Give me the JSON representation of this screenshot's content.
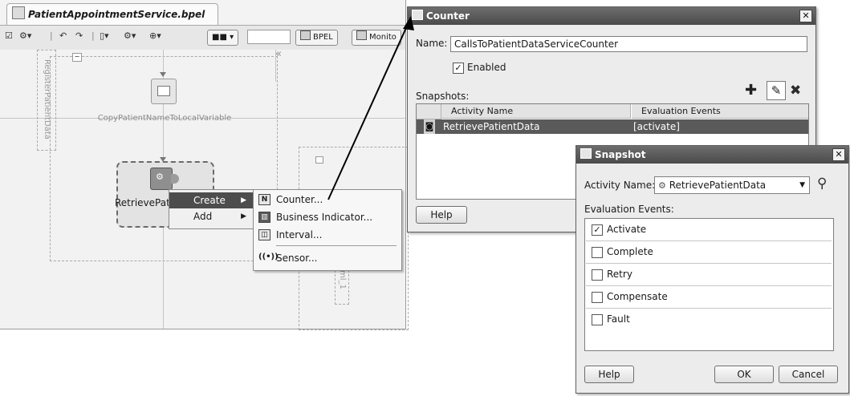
{
  "editor": {
    "tab_title": "PatientAppointmentService.bpel",
    "toolbar": {
      "bpel_button": "BPEL",
      "monitor_button": "Monito"
    },
    "canvas": {
      "swimlane_label": "RegisterPatientData",
      "activity1_label": "CopyPatientNameToLocalVariable",
      "activity2_label": "RetrievePat",
      "side_label": "ml_1"
    }
  },
  "context_menu": {
    "items": [
      {
        "label": "Create"
      },
      {
        "label": "Add"
      }
    ],
    "submenu": [
      {
        "icon": "N",
        "label": "Counter..."
      },
      {
        "icon": "BI",
        "label": "Business Indicator..."
      },
      {
        "icon": "IV",
        "label": "Interval..."
      },
      {
        "icon": "SN",
        "label": "Sensor..."
      }
    ]
  },
  "counter_dialog": {
    "title": "Counter",
    "name_label": "Name:",
    "name_value": "CallsToPatientDataServiceCounter",
    "enabled_label": "Enabled",
    "enabled_checked": true,
    "snapshots_label": "Snapshots:",
    "columns": [
      "Activity Name",
      "Evaluation Events"
    ],
    "rows": [
      {
        "activity": "RetrievePatientData",
        "events": "[activate]"
      }
    ],
    "help_button": "Help"
  },
  "snapshot_dialog": {
    "title": "Snapshot",
    "activity_label": "Activity Name:",
    "activity_value": "RetrievePatientData",
    "events_label": "Evaluation Events:",
    "events": [
      {
        "label": "Activate",
        "checked": true
      },
      {
        "label": "Complete",
        "checked": false
      },
      {
        "label": "Retry",
        "checked": false
      },
      {
        "label": "Compensate",
        "checked": false
      },
      {
        "label": "Fault",
        "checked": false
      }
    ],
    "help_button": "Help",
    "ok_button": "OK",
    "cancel_button": "Cancel"
  },
  "colors": {
    "title_bar": "#555555",
    "selected_row": "#5a5a5a",
    "callout_arrow": "#000000"
  }
}
